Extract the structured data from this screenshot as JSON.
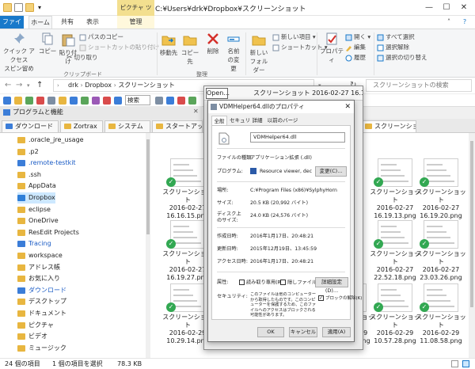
{
  "window": {
    "title": "C:¥Users¥drk¥Dropbox¥スクリーンショット",
    "context_tab": "ピクチャ ツール"
  },
  "ribbon_tabs": [
    "ファイル",
    "ホーム",
    "共有",
    "表示",
    "管理"
  ],
  "ribbon": {
    "quick_access": "クイック アクセス\nスピン留め",
    "copy": "コピー",
    "paste": "貼り付け",
    "copy_path": "パスのコピー",
    "paste_shortcut": "ショートカットの貼り付け",
    "cut": "切り取り",
    "clipboard_group": "クリップボード",
    "move_to": "移動先",
    "copy_to": "コピー先",
    "delete": "削除",
    "rename": "名前の変更",
    "organize_group": "整理",
    "new_folder": "新しいフォルダー",
    "new_item": "新しい項目",
    "shortcut": "ショートカット",
    "properties": "プロパティ",
    "open": "開く",
    "edit": "編集",
    "history": "履歴",
    "select_all": "すべて選択",
    "select_none": "選択解除",
    "invert_selection": "選択の切り替え"
  },
  "address": {
    "path": [
      "drk",
      "Dropbox",
      "スクリーンショット"
    ],
    "search_placeholder": "スクリーンショットの検索"
  },
  "toolbar": {
    "search_label": "検索"
  },
  "favorites": {
    "label": "プログラムと機能"
  },
  "tabs": [
    "ダウンロード",
    "Zortrax",
    "システム",
    "スタートアップ",
    "スクリーンショット"
  ],
  "nav_items": [
    {
      "label": ".oracle_jre_usage",
      "color": "normal"
    },
    {
      "label": ".p2",
      "color": "normal"
    },
    {
      "label": ".remote-testkit",
      "color": "blue"
    },
    {
      "label": ".ssh",
      "color": "normal"
    },
    {
      "label": "AppData",
      "color": "normal"
    },
    {
      "label": "Dropbox",
      "color": "selected"
    },
    {
      "label": "eclipse",
      "color": "normal"
    },
    {
      "label": "OneDrive",
      "color": "normal"
    },
    {
      "label": "ResEdit Projects",
      "color": "normal"
    },
    {
      "label": "Tracing",
      "color": "blue"
    },
    {
      "label": "workspace",
      "color": "normal"
    },
    {
      "label": "アドレス帳",
      "color": "normal"
    },
    {
      "label": "お気に入り",
      "color": "normal"
    },
    {
      "label": "ダウンロード",
      "color": "blue"
    },
    {
      "label": "デスクトップ",
      "color": "normal"
    },
    {
      "label": "ドキュメント",
      "color": "normal"
    },
    {
      "label": "ピクチャ",
      "color": "normal"
    },
    {
      "label": "ビデオ",
      "color": "normal"
    },
    {
      "label": "ミュージック",
      "color": "normal"
    }
  ],
  "files": [
    {
      "name": "スクリーンショット\n2016-02-27\n16.16.15.png",
      "col": 0,
      "row": 0
    },
    {
      "name": "スクリーンショット\n2016-02-27\n16.19.13.png",
      "col": 4,
      "row": 0
    },
    {
      "name": "スクリーンショット\n2016-02-27\n16.19.20.png",
      "col": 5,
      "row": 0
    },
    {
      "name": "スクリーンショット\n2016-02-27\n16.19.27.png",
      "col": 0,
      "row": 1
    },
    {
      "name": "スクリーンショット\n2016-02-27\n22.52.18.png",
      "col": 4,
      "row": 1
    },
    {
      "name": "スクリーンショット\n2016-02-27\n23.03.26.png",
      "col": 5,
      "row": 1
    },
    {
      "name": "スクリーンショット\n2016-02-29\n10.29.14.png",
      "col": 0,
      "row": 2
    },
    {
      "name": "スクリーンショット\n2016-02-29\n10.34.20.png",
      "col": 1,
      "row": 2
    },
    {
      "name": "スクリーンショット\n2016-02-29\n10.56.03.png",
      "col": 2,
      "row": 2
    },
    {
      "name": "スクリーンショット\n2016-02-29\n10.56.38.png",
      "col": 3,
      "row": 2
    },
    {
      "name": "スクリーンショット\n2016-02-29\n10.57.28.png",
      "col": 4,
      "row": 2
    },
    {
      "name": "スクリーンショット\n2016-02-29\n11.08.58.png",
      "col": 5,
      "row": 2
    }
  ],
  "status": {
    "count": "24 個の項目",
    "selected": "1 個の項目を選択",
    "size": "78.3 KB"
  },
  "viewer": {
    "open_label": "Open...",
    "title": "スクリーンショット 2016-02-27 16.17.19.png"
  },
  "dialog": {
    "title": "VDMHelper64.dllのプロパティ",
    "tabs": [
      "全般",
      "セキュリティ",
      "詳細",
      "以前のバージョン"
    ],
    "filename": "VDMHelper64.dll",
    "rows": [
      {
        "label": "ファイルの種類:",
        "value": "アプリケーション拡張 (.dll)"
      },
      {
        "label": "プログラム:",
        "value": "Resource viewer, decompiler &"
      },
      {
        "label": "場所:",
        "value": "C:¥Program Files (x86)¥SylphyHorn"
      },
      {
        "label": "サイズ:",
        "value": "20.5 KB (20,992 バイト)"
      },
      {
        "label": "ディスク上\nのサイズ:",
        "value": "24.0 KB (24,576 バイト)"
      },
      {
        "label": "作成日時:",
        "value": "2016年1月17日、20:48:21"
      },
      {
        "label": "更新日時:",
        "value": "2015年12月19日、13:45:59"
      },
      {
        "label": "アクセス日時:",
        "value": "2016年1月17日、20:48:21"
      }
    ],
    "change_btn": "変更(C)...",
    "attr_label": "属性:",
    "readonly": "読み取り専用(R)",
    "hidden": "隠しファイル(H)",
    "detail_btn": "詳細設定(D)...",
    "security_label": "セキュリティ:",
    "security_text": "このファイルは他のコンピューターから取得したものです。このコンピューターを保護するため、このファイルへのアクセスはブロックされる可能性があります。",
    "unblock": "ブロックの解除(K)",
    "ok": "OK",
    "cancel": "キャンセル",
    "apply": "適用(A)"
  }
}
